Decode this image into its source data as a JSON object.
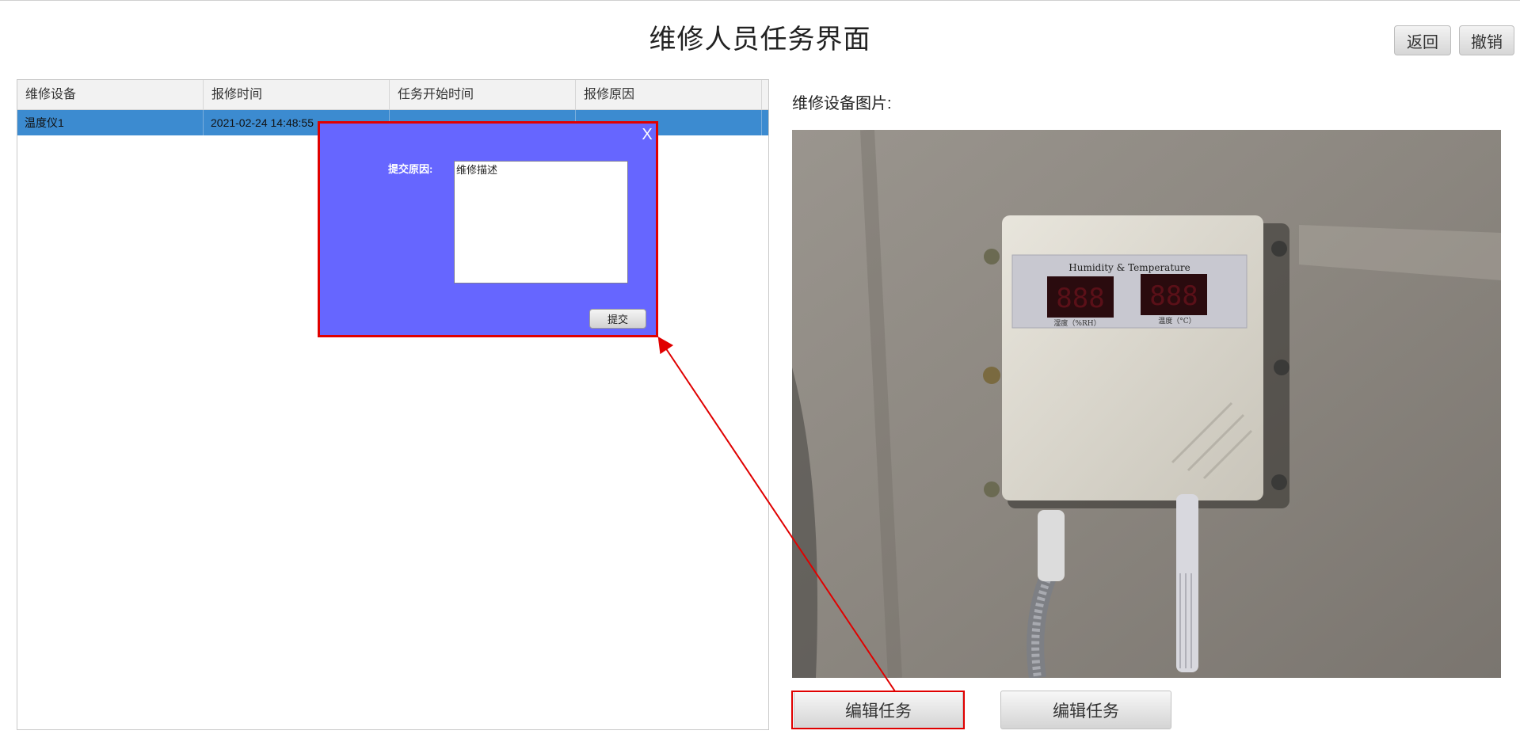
{
  "page": {
    "title": "维修人员任务界面"
  },
  "toolbar": {
    "back_label": "返回",
    "undo_label": "撤销"
  },
  "table": {
    "headers": [
      "维修设备",
      "报修时间",
      "任务开始时间",
      "报修原因"
    ],
    "rows": [
      {
        "device": "温度仪1",
        "report_time": "2021-02-24 14:48:55",
        "start_time": "",
        "reason": ""
      }
    ]
  },
  "photo": {
    "label": "维修设备图片:",
    "device_panel_title": "Humidity & Temperature",
    "humidity_caption": "湿度（%RH）",
    "temperature_caption": "温度（°C）"
  },
  "actions": {
    "edit_task_1": "编辑任务",
    "edit_task_2": "编辑任务"
  },
  "dialog": {
    "close_label": "X",
    "reason_label": "提交原因:",
    "reason_value": "维修描述",
    "submit_label": "提交"
  },
  "colors": {
    "selected_row": "#3c8bd0",
    "dialog_bg": "#6666ff",
    "highlight": "#e00000"
  }
}
